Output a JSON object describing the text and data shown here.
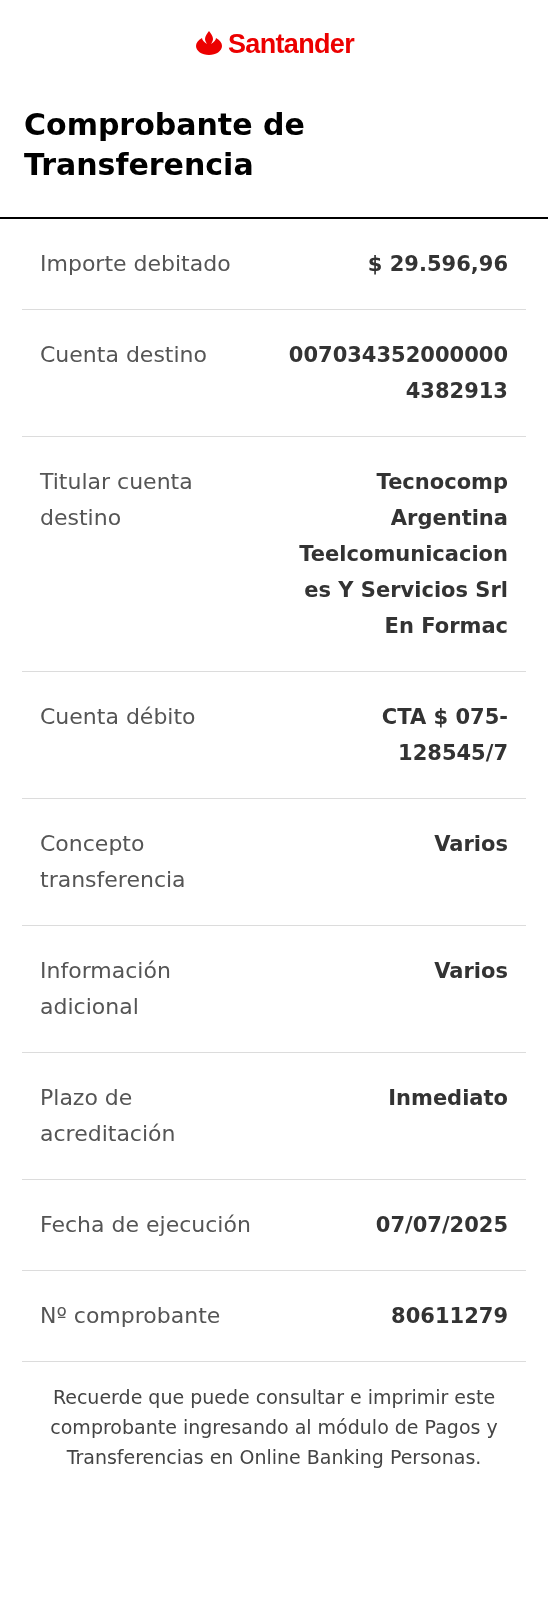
{
  "logo": {
    "text": "Santander"
  },
  "title": "Comprobante de Transferencia",
  "rows": [
    {
      "label": "Importe debitado",
      "value": "$ 29.596,96"
    },
    {
      "label": "Cuenta destino",
      "value": "0070343520000004382913"
    },
    {
      "label": "Titular cuenta destino",
      "value": "Tecnocomp Argentina Teelcomunicaciones Y Servicios Srl En Formac"
    },
    {
      "label": "Cuenta débito",
      "value": "CTA $ 075-128545/7"
    },
    {
      "label": "Concepto transferencia",
      "value": "Varios"
    },
    {
      "label": "Información adicional",
      "value": "Varios"
    },
    {
      "label": "Plazo de acreditación",
      "value": "Inmediato"
    },
    {
      "label": "Fecha de ejecución",
      "value": "07/07/2025"
    },
    {
      "label": "Nº comprobante",
      "value": "80611279"
    }
  ],
  "note": "Recuerde que puede consultar e imprimir este comprobante ingresando al módulo de Pagos y Transferencias en Online Banking Personas."
}
